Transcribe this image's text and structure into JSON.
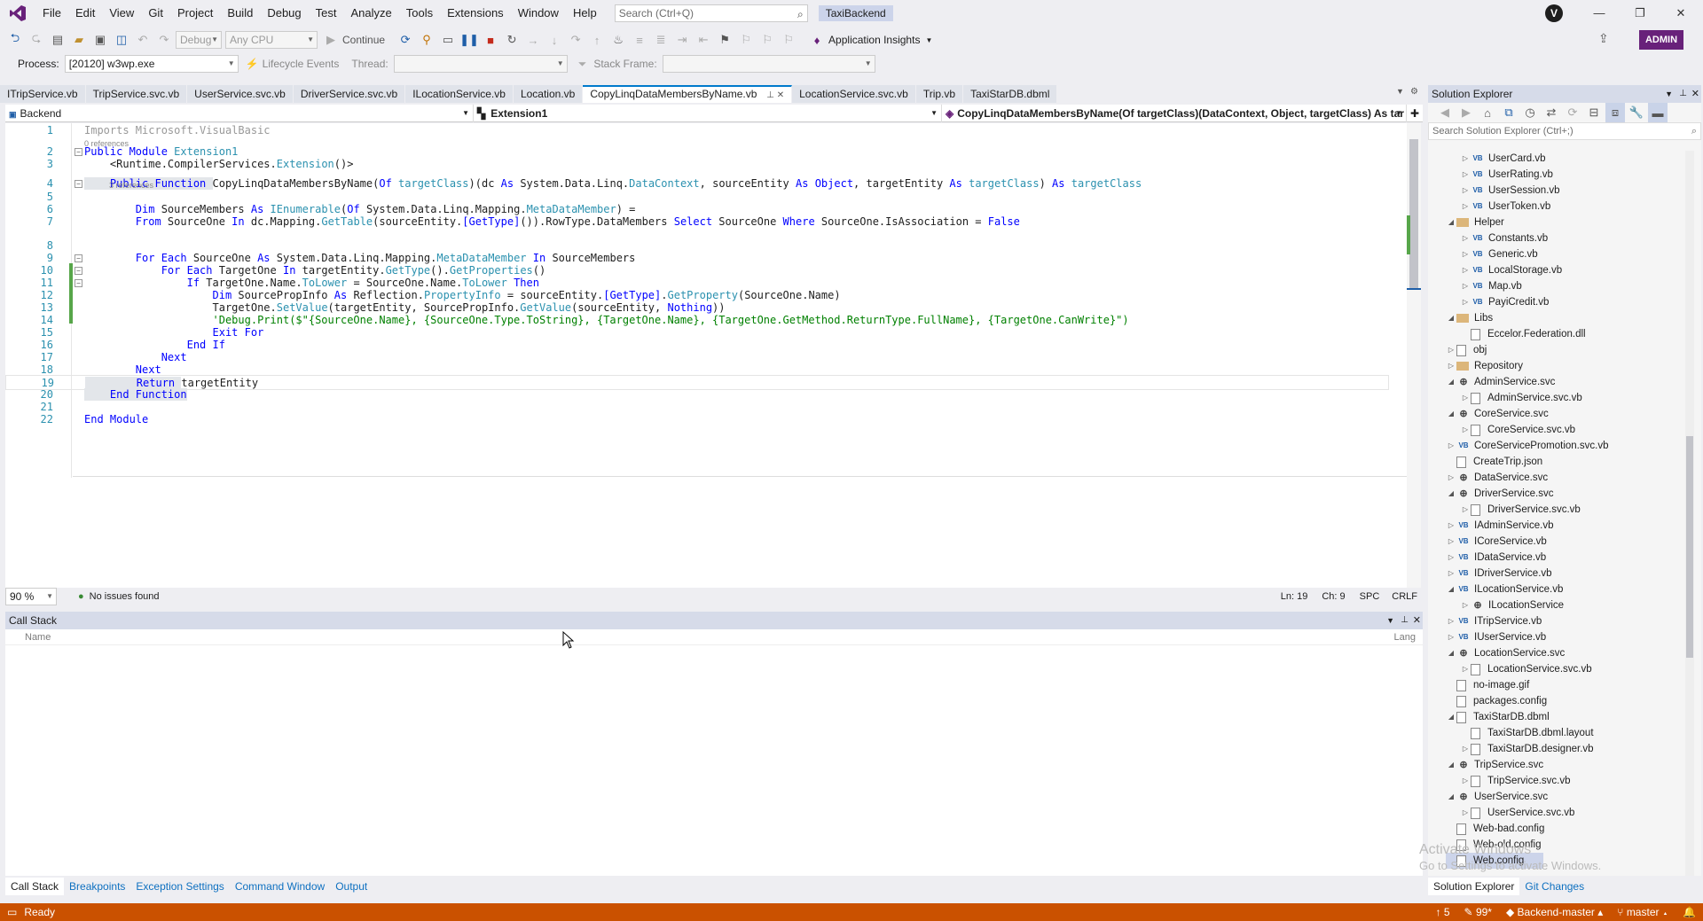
{
  "menu": {
    "items": [
      "File",
      "Edit",
      "View",
      "Git",
      "Project",
      "Build",
      "Debug",
      "Test",
      "Analyze",
      "Tools",
      "Extensions",
      "Window",
      "Help"
    ],
    "search_placeholder": "Search (Ctrl+Q)",
    "solution_name": "TaxiBackend",
    "account_initial": "V"
  },
  "toolbar": {
    "config": "Debug",
    "platform": "Any CPU",
    "continue_label": "Continue",
    "app_insights": "Application Insights",
    "admin_badge": "ADMIN",
    "process_label": "Process:",
    "process_value": "[20120] w3wp.exe",
    "lifecycle_label": "Lifecycle Events",
    "thread_label": "Thread:",
    "stack_frame_label": "Stack Frame:"
  },
  "tabs": [
    "ITripService.vb",
    "TripService.svc.vb",
    "UserService.svc.vb",
    "DriverService.svc.vb",
    "ILocationService.vb",
    "Location.vb",
    "CopyLinqDataMembersByName.vb",
    "LocationService.svc.vb",
    "Trip.vb",
    "TaxiStarDB.dbml"
  ],
  "active_tab": "CopyLinqDataMembersByName.vb",
  "navbar": {
    "project": "Backend",
    "module": "Extension1",
    "member": "CopyLinqDataMembersByName(Of targetClass)(DataContext, Object, targetClass) As tar"
  },
  "code": {
    "lines": [
      {
        "n": "1",
        "segs": [
          [
            "gr",
            "Imports Microsoft.VisualBasic"
          ]
        ]
      },
      {
        "n": "2",
        "segs": [
          [
            "kw",
            "Public Module "
          ],
          [
            "ty",
            "Extension1"
          ]
        ]
      },
      {
        "n": "3",
        "segs": [
          [
            "",
            "    <Runtime.CompilerServices."
          ],
          [
            "ty",
            "Extension"
          ],
          [
            "",
            "()>"
          ]
        ]
      },
      {
        "n": "4",
        "segs": [
          [
            "kw",
            "    Public Function "
          ],
          [
            "",
            "CopyLinqDataMembersByName("
          ],
          [
            "kw",
            "Of "
          ],
          [
            "ty",
            "targetClass"
          ],
          [
            "",
            ")(dc "
          ],
          [
            "kw",
            "As "
          ],
          [
            "",
            "System.Data.Linq."
          ],
          [
            "ty",
            "DataContext"
          ],
          [
            "",
            ", sourceEntity "
          ],
          [
            "kw",
            "As Object"
          ],
          [
            "",
            ", targetEntity "
          ],
          [
            "kw",
            "As "
          ],
          [
            "ty",
            "targetClass"
          ],
          [
            "",
            ") "
          ],
          [
            "kw",
            "As "
          ],
          [
            "ty",
            "targetClass"
          ]
        ]
      },
      {
        "n": "5",
        "segs": [
          [
            "",
            ""
          ]
        ]
      },
      {
        "n": "6",
        "segs": [
          [
            "kw",
            "        Dim "
          ],
          [
            "",
            "SourceMembers "
          ],
          [
            "kw",
            "As "
          ],
          [
            "ty",
            "IEnumerable"
          ],
          [
            "",
            "("
          ],
          [
            "kw",
            "Of "
          ],
          [
            "",
            "System.Data.Linq.Mapping."
          ],
          [
            "ty",
            "MetaDataMember"
          ],
          [
            "",
            ") ="
          ]
        ]
      },
      {
        "n": "7",
        "segs": [
          [
            "kw",
            "        From "
          ],
          [
            "",
            "SourceOne "
          ],
          [
            "kw",
            "In "
          ],
          [
            "",
            "dc.Mapping."
          ],
          [
            "ty",
            "GetTable"
          ],
          [
            "",
            "(sourceEntity."
          ],
          [
            "kw",
            "[GetType]"
          ],
          [
            "",
            "()).RowType.DataMembers "
          ],
          [
            "kw",
            "Select "
          ],
          [
            "",
            "SourceOne "
          ],
          [
            "kw",
            "Where "
          ],
          [
            "",
            "SourceOne.IsAssociation = "
          ],
          [
            "kw",
            "False"
          ]
        ]
      },
      {
        "n": "8",
        "segs": [
          [
            "",
            ""
          ]
        ]
      },
      {
        "n": "9",
        "segs": [
          [
            "kw",
            "        For Each "
          ],
          [
            "",
            "SourceOne "
          ],
          [
            "kw",
            "As "
          ],
          [
            "",
            "System.Data.Linq.Mapping."
          ],
          [
            "ty",
            "MetaDataMember "
          ],
          [
            "kw",
            "In "
          ],
          [
            "",
            "SourceMembers"
          ]
        ]
      },
      {
        "n": "10",
        "segs": [
          [
            "kw",
            "            For Each "
          ],
          [
            "",
            "TargetOne "
          ],
          [
            "kw",
            "In "
          ],
          [
            "",
            "targetEntity."
          ],
          [
            "ty",
            "GetType"
          ],
          [
            "",
            "()."
          ],
          [
            "ty",
            "GetProperties"
          ],
          [
            "",
            "()"
          ]
        ]
      },
      {
        "n": "11",
        "segs": [
          [
            "kw",
            "                If "
          ],
          [
            "",
            "TargetOne.Name."
          ],
          [
            "ty",
            "ToLower"
          ],
          [
            "",
            "",
            " = SourceOne.Name."
          ],
          [
            "ty",
            "ToLower "
          ],
          [
            "kw",
            "Then"
          ]
        ]
      },
      {
        "n": "12",
        "segs": [
          [
            "kw",
            "                    Dim "
          ],
          [
            "",
            "SourcePropInfo "
          ],
          [
            "kw",
            "As "
          ],
          [
            "",
            "Reflection."
          ],
          [
            "ty",
            "PropertyInfo"
          ],
          [
            "",
            "",
            " = sourceEntity."
          ],
          [
            "kw",
            "[GetType]"
          ],
          [
            "",
            "."
          ],
          [
            "ty",
            "GetProperty"
          ],
          [
            "",
            "(SourceOne.Name)"
          ]
        ]
      },
      {
        "n": "13",
        "segs": [
          [
            "",
            "                    TargetOne."
          ],
          [
            "ty",
            "SetValue"
          ],
          [
            "",
            "(targetEntity, SourcePropInfo."
          ],
          [
            "ty",
            "GetValue"
          ],
          [
            "",
            "(sourceEntity, "
          ],
          [
            "kw",
            "Nothing"
          ],
          [
            "",
            "))"
          ]
        ]
      },
      {
        "n": "14",
        "segs": [
          [
            "cm",
            "                    'Debug.Print($\"{SourceOne.Name}, {SourceOne.Type.ToString}, {TargetOne.Name}, {TargetOne.GetMethod.ReturnType.FullName}, {TargetOne.CanWrite}\")"
          ]
        ]
      },
      {
        "n": "15",
        "segs": [
          [
            "kw",
            "                    Exit For"
          ]
        ]
      },
      {
        "n": "16",
        "segs": [
          [
            "kw",
            "                End If"
          ]
        ]
      },
      {
        "n": "17",
        "segs": [
          [
            "kw",
            "            Next"
          ]
        ]
      },
      {
        "n": "18",
        "segs": [
          [
            "kw",
            "        Next"
          ]
        ]
      },
      {
        "n": "19",
        "segs": [
          [
            "kw",
            "        Return "
          ],
          [
            "",
            "targetEntity"
          ]
        ]
      },
      {
        "n": "20",
        "segs": [
          [
            "kw",
            "    End Function"
          ]
        ]
      },
      {
        "n": "21",
        "segs": [
          [
            "",
            ""
          ]
        ]
      },
      {
        "n": "22",
        "segs": [
          [
            "kw",
            "End Module"
          ]
        ]
      }
    ],
    "lens_0": "0 references",
    "lens_3": "3 references"
  },
  "editor_status": {
    "zoom": "90 %",
    "issues": "No issues found",
    "line": "Ln: 19",
    "col": "Ch: 9",
    "spc": "SPC",
    "crlf": "CRLF"
  },
  "callstack": {
    "title": "Call Stack",
    "col_name": "Name",
    "col_lang": "Lang"
  },
  "bottom_tabs": [
    "Call Stack",
    "Breakpoints",
    "Exception Settings",
    "Command Window",
    "Output"
  ],
  "solution_explorer": {
    "title": "Solution Explorer",
    "search_placeholder": "Search Solution Explorer (Ctrl+;)",
    "items": [
      {
        "label": "UserCard.vb",
        "indent": 2,
        "icon": "vb",
        "tri": "▷"
      },
      {
        "label": "UserRating.vb",
        "indent": 2,
        "icon": "vb",
        "tri": "▷"
      },
      {
        "label": "UserSession.vb",
        "indent": 2,
        "icon": "vb",
        "tri": "▷"
      },
      {
        "label": "UserToken.vb",
        "indent": 2,
        "icon": "vb",
        "tri": "▷"
      },
      {
        "label": "Helper",
        "indent": 1,
        "icon": "folder",
        "tri": "◢"
      },
      {
        "label": "Constants.vb",
        "indent": 2,
        "icon": "vb",
        "tri": "▷"
      },
      {
        "label": "Generic.vb",
        "indent": 2,
        "icon": "vb",
        "tri": "▷"
      },
      {
        "label": "LocalStorage.vb",
        "indent": 2,
        "icon": "vb",
        "tri": "▷"
      },
      {
        "label": "Map.vb",
        "indent": 2,
        "icon": "vb",
        "tri": "▷"
      },
      {
        "label": "PayiCredit.vb",
        "indent": 2,
        "icon": "vb",
        "tri": "▷"
      },
      {
        "label": "Libs",
        "indent": 1,
        "icon": "folder",
        "tri": "◢"
      },
      {
        "label": "Eccelor.Federation.dll",
        "indent": 2,
        "icon": "file",
        "tri": ""
      },
      {
        "label": "obj",
        "indent": 1,
        "icon": "file",
        "tri": "▷"
      },
      {
        "label": "Repository",
        "indent": 1,
        "icon": "folder",
        "tri": "▷"
      },
      {
        "label": "AdminService.svc",
        "indent": 1,
        "icon": "svc",
        "tri": "◢"
      },
      {
        "label": "AdminService.svc.vb",
        "indent": 2,
        "icon": "file",
        "tri": "▷"
      },
      {
        "label": "CoreService.svc",
        "indent": 1,
        "icon": "svc",
        "tri": "◢"
      },
      {
        "label": "CoreService.svc.vb",
        "indent": 2,
        "icon": "file",
        "tri": "▷"
      },
      {
        "label": "CoreServicePromotion.svc.vb",
        "indent": 1,
        "icon": "vb",
        "tri": "▷"
      },
      {
        "label": "CreateTrip.json",
        "indent": 1,
        "icon": "file",
        "tri": ""
      },
      {
        "label": "DataService.svc",
        "indent": 1,
        "icon": "svc",
        "tri": "▷"
      },
      {
        "label": "DriverService.svc",
        "indent": 1,
        "icon": "svc",
        "tri": "◢"
      },
      {
        "label": "DriverService.svc.vb",
        "indent": 2,
        "icon": "file",
        "tri": "▷"
      },
      {
        "label": "IAdminService.vb",
        "indent": 1,
        "icon": "vb",
        "tri": "▷"
      },
      {
        "label": "ICoreService.vb",
        "indent": 1,
        "icon": "vb",
        "tri": "▷"
      },
      {
        "label": "IDataService.vb",
        "indent": 1,
        "icon": "vb",
        "tri": "▷"
      },
      {
        "label": "IDriverService.vb",
        "indent": 1,
        "icon": "vb",
        "tri": "▷"
      },
      {
        "label": "ILocationService.vb",
        "indent": 1,
        "icon": "vb",
        "tri": "◢"
      },
      {
        "label": "ILocationService",
        "indent": 2,
        "icon": "svc",
        "tri": "▷"
      },
      {
        "label": "ITripService.vb",
        "indent": 1,
        "icon": "vb",
        "tri": "▷"
      },
      {
        "label": "IUserService.vb",
        "indent": 1,
        "icon": "vb",
        "tri": "▷"
      },
      {
        "label": "LocationService.svc",
        "indent": 1,
        "icon": "svc",
        "tri": "◢"
      },
      {
        "label": "LocationService.svc.vb",
        "indent": 2,
        "icon": "file",
        "tri": "▷"
      },
      {
        "label": "no-image.gif",
        "indent": 1,
        "icon": "file",
        "tri": ""
      },
      {
        "label": "packages.config",
        "indent": 1,
        "icon": "file",
        "tri": ""
      },
      {
        "label": "TaxiStarDB.dbml",
        "indent": 1,
        "icon": "file",
        "tri": "◢"
      },
      {
        "label": "TaxiStarDB.dbml.layout",
        "indent": 2,
        "icon": "file",
        "tri": ""
      },
      {
        "label": "TaxiStarDB.designer.vb",
        "indent": 2,
        "icon": "file",
        "tri": "▷"
      },
      {
        "label": "TripService.svc",
        "indent": 1,
        "icon": "svc",
        "tri": "◢"
      },
      {
        "label": "TripService.svc.vb",
        "indent": 2,
        "icon": "file",
        "tri": "▷"
      },
      {
        "label": "UserService.svc",
        "indent": 1,
        "icon": "svc",
        "tri": "◢"
      },
      {
        "label": "UserService.svc.vb",
        "indent": 2,
        "icon": "file",
        "tri": "▷"
      },
      {
        "label": "Web-bad.config",
        "indent": 1,
        "icon": "file",
        "tri": ""
      },
      {
        "label": "Web-old.config",
        "indent": 1,
        "icon": "file",
        "tri": ""
      },
      {
        "label": "Web.config",
        "indent": 1,
        "icon": "file",
        "tri": "",
        "selected": true
      }
    ],
    "tabs": [
      "Solution Explorer",
      "Git Changes"
    ]
  },
  "statusbar": {
    "ready": "Ready",
    "up_count": "5",
    "pencil_count": "99*",
    "repo": "Backend-master",
    "branch": "master"
  },
  "watermark": {
    "line1": "Activate Windows",
    "line2": "Go to Settings to activate Windows."
  },
  "colors": {
    "accent": "#007acc",
    "status_bar": "#ca5100",
    "admin_badge": "#68217a"
  }
}
